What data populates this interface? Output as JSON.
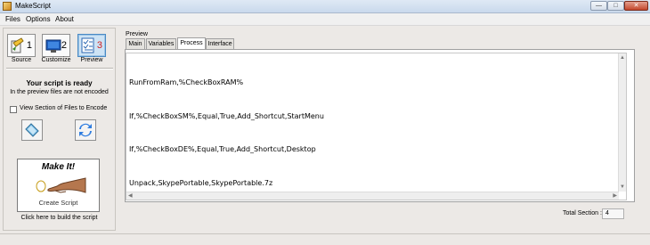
{
  "window": {
    "title": "MakeScript"
  },
  "menu": {
    "items": [
      "Files",
      "Options",
      "About"
    ]
  },
  "toolbar": {
    "source": {
      "label": "Source",
      "number": "1"
    },
    "customize": {
      "label": "Customize",
      "number": "2"
    },
    "preview": {
      "label": "Preview",
      "number": "3"
    }
  },
  "status": {
    "title": "Your script is ready",
    "subtitle": "In the preview files are not encoded"
  },
  "view_section": {
    "label": "View Section of Files to Encode",
    "checked": false
  },
  "make_it": {
    "title": "Make It!",
    "subtitle": "Create Script",
    "hint": "Click here to build the script"
  },
  "preview": {
    "label": "Preview",
    "tabs": [
      "Main",
      "Variables",
      "Process",
      "Interface"
    ],
    "active_tab": "Process",
    "lines": [
      "RunFromRam,%CheckBoxRAM%",
      "If,%CheckBoxSM%,Equal,True,Add_Shortcut,StartMenu",
      "If,%CheckBoxDE%,Equal,True,Add_Shortcut,Desktop",
      "Unpack,SkypePortable,SkypePortable.7z"
    ]
  },
  "total_section": {
    "label": "Total Section :",
    "value": "4"
  },
  "icons": [
    "app-icon",
    "source-icon",
    "customize-icon",
    "preview-icon",
    "encode-icon",
    "refresh-icon",
    "hand-icon",
    "minimize-icon",
    "maximize-icon",
    "close-icon"
  ],
  "colors": {
    "accent": "#4a8ac4",
    "close": "#c4472c",
    "preview_number": "#d02020"
  }
}
